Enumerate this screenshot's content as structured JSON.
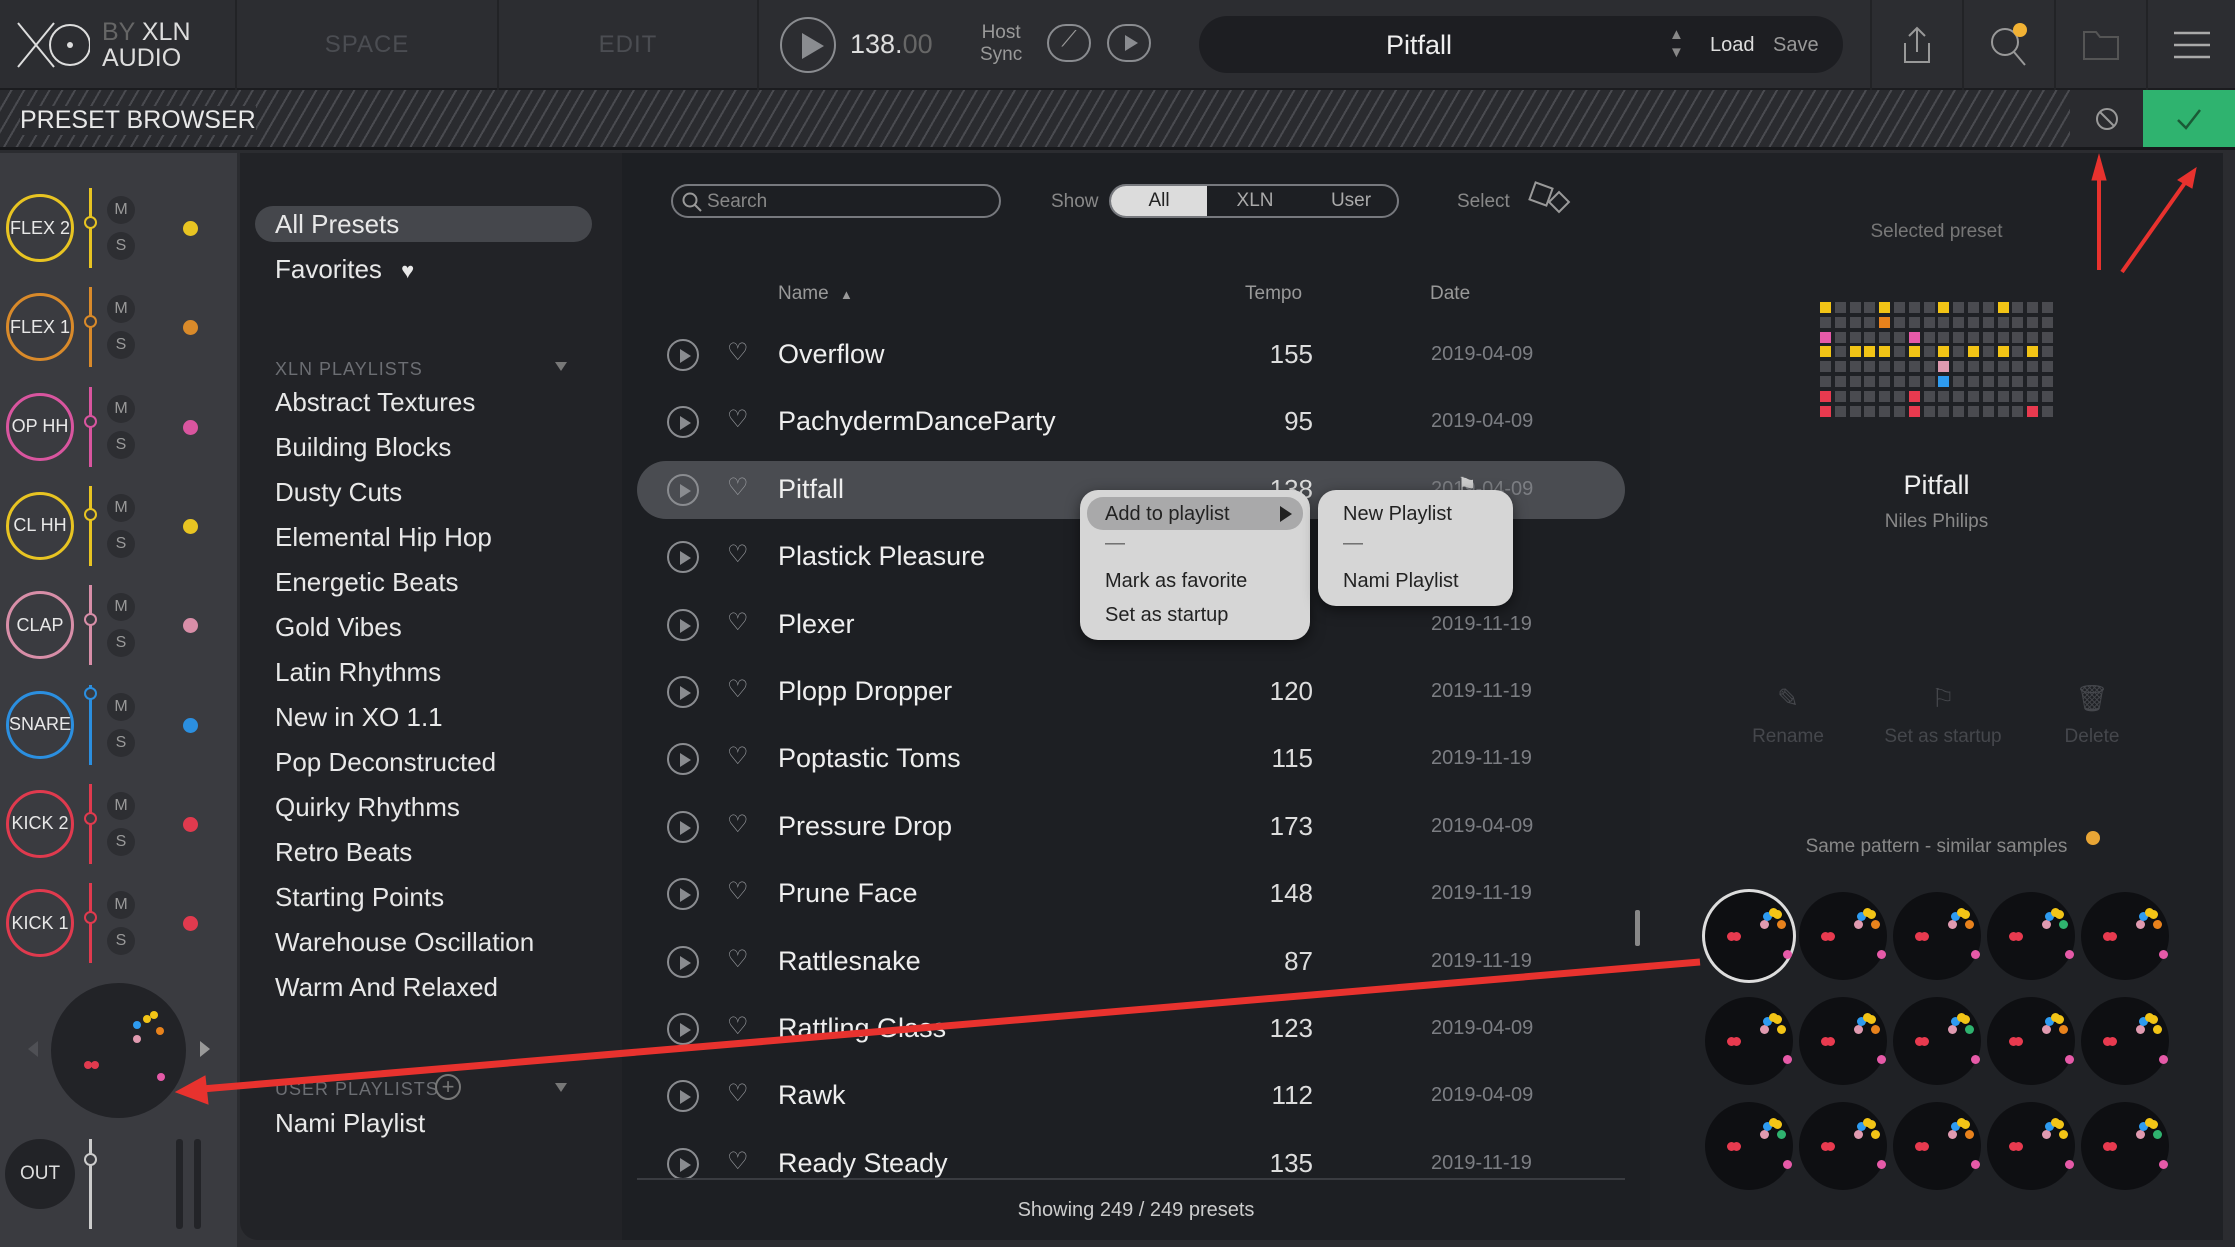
{
  "topbar": {
    "logo_text": "XO",
    "logo_by": "BY",
    "logo_brand": "XLN",
    "logo_audio": "AUDIO",
    "tabs": [
      {
        "label": "SPACE"
      },
      {
        "label": "EDIT"
      }
    ],
    "tempo_int": "138.",
    "tempo_dec": "00",
    "host_sync_1": "Host",
    "host_sync_2": "Sync",
    "preset_name": "Pitfall",
    "load_label": "Load",
    "save_label": "Save"
  },
  "browser_bar": {
    "title": "PRESET BROWSER"
  },
  "channels": [
    {
      "label": "FLEX 2",
      "color": "#e8c422"
    },
    {
      "label": "FLEX 1",
      "color": "#d98a2a"
    },
    {
      "label": "OP HH",
      "color": "#d9559f"
    },
    {
      "label": "CL HH",
      "color": "#e8c422"
    },
    {
      "label": "CLAP",
      "color": "#d88ea8"
    },
    {
      "label": "SNARE",
      "color": "#2b8fe0"
    },
    {
      "label": "KICK 2",
      "color": "#e03a4e"
    },
    {
      "label": "KICK 1",
      "color": "#e03a4e"
    }
  ],
  "mute_label": "M",
  "solo_label": "S",
  "out_label": "OUT",
  "sidebar": {
    "all_presets": "All Presets",
    "favorites": "Favorites",
    "xln_header": "XLN PLAYLISTS",
    "xln_playlists": [
      "Abstract Textures",
      "Building Blocks",
      "Dusty Cuts",
      "Elemental Hip Hop",
      "Energetic Beats",
      "Gold Vibes",
      "Latin Rhythms",
      "New in XO 1.1",
      "Pop Deconstructed",
      "Quirky Rhythms",
      "Retro Beats",
      "Starting Points",
      "Warehouse Oscillation",
      "Warm And Relaxed"
    ],
    "user_header": "USER PLAYLISTS",
    "user_playlists": [
      "Nami Playlist"
    ]
  },
  "list": {
    "search_placeholder": "Search",
    "show_label": "Show",
    "filters": [
      "All",
      "XLN",
      "User"
    ],
    "active_filter": "All",
    "select_label": "Select",
    "col_name": "Name",
    "col_tempo": "Tempo",
    "col_date": "Date",
    "rows": [
      {
        "name": "Overflow",
        "tempo": "155",
        "date": "2019-04-09"
      },
      {
        "name": "PachydermDanceParty",
        "tempo": "95",
        "date": "2019-04-09"
      },
      {
        "name": "Pitfall",
        "tempo": "138",
        "date": "2019-04-09",
        "selected": true
      },
      {
        "name": "Plastick Pleasure",
        "tempo": "",
        "date": ""
      },
      {
        "name": "Plexer",
        "tempo": "",
        "date": "2019-11-19"
      },
      {
        "name": "Plopp Dropper",
        "tempo": "120",
        "date": "2019-11-19"
      },
      {
        "name": "Poptastic Toms",
        "tempo": "115",
        "date": "2019-11-19"
      },
      {
        "name": "Pressure Drop",
        "tempo": "173",
        "date": "2019-04-09"
      },
      {
        "name": "Prune Face",
        "tempo": "148",
        "date": "2019-11-19"
      },
      {
        "name": "Rattlesnake",
        "tempo": "87",
        "date": "2019-11-19"
      },
      {
        "name": "Rattling Glass",
        "tempo": "123",
        "date": "2019-04-09"
      },
      {
        "name": "Rawk",
        "tempo": "112",
        "date": "2019-04-09"
      },
      {
        "name": "Ready Steady",
        "tempo": "135",
        "date": "2019-11-19"
      }
    ],
    "footer": "Showing 249 / 249 presets"
  },
  "context_menu": {
    "items": [
      "Add to playlist",
      "—",
      "Mark as favorite",
      "Set as startup"
    ]
  },
  "submenu": {
    "items": [
      "New Playlist",
      "—",
      "Nami Playlist"
    ]
  },
  "detail": {
    "header": "Selected preset",
    "name": "Pitfall",
    "author": "Niles Philips",
    "actions": [
      "Rename",
      "Set as startup",
      "Delete"
    ],
    "similar_label": "Same pattern - similar samples",
    "pattern": {
      "rows": [
        "1000100010001000",
        "0000100000000000",
        "1000001000000000",
        "1011101010101010",
        "0000000010000000",
        "0000000010000000",
        "1000001000000000",
        "1000001000000010"
      ],
      "colors": [
        "#f2c416",
        "#e8821c",
        "#e65aa8",
        "#f2c416",
        "#e09ab0",
        "#2e9bf0",
        "#e83a4f",
        "#e83a4f"
      ],
      "off": "#4a4b50"
    }
  },
  "colors": {
    "accent_green": "#2fb36f",
    "annotation": "#e8322e"
  }
}
